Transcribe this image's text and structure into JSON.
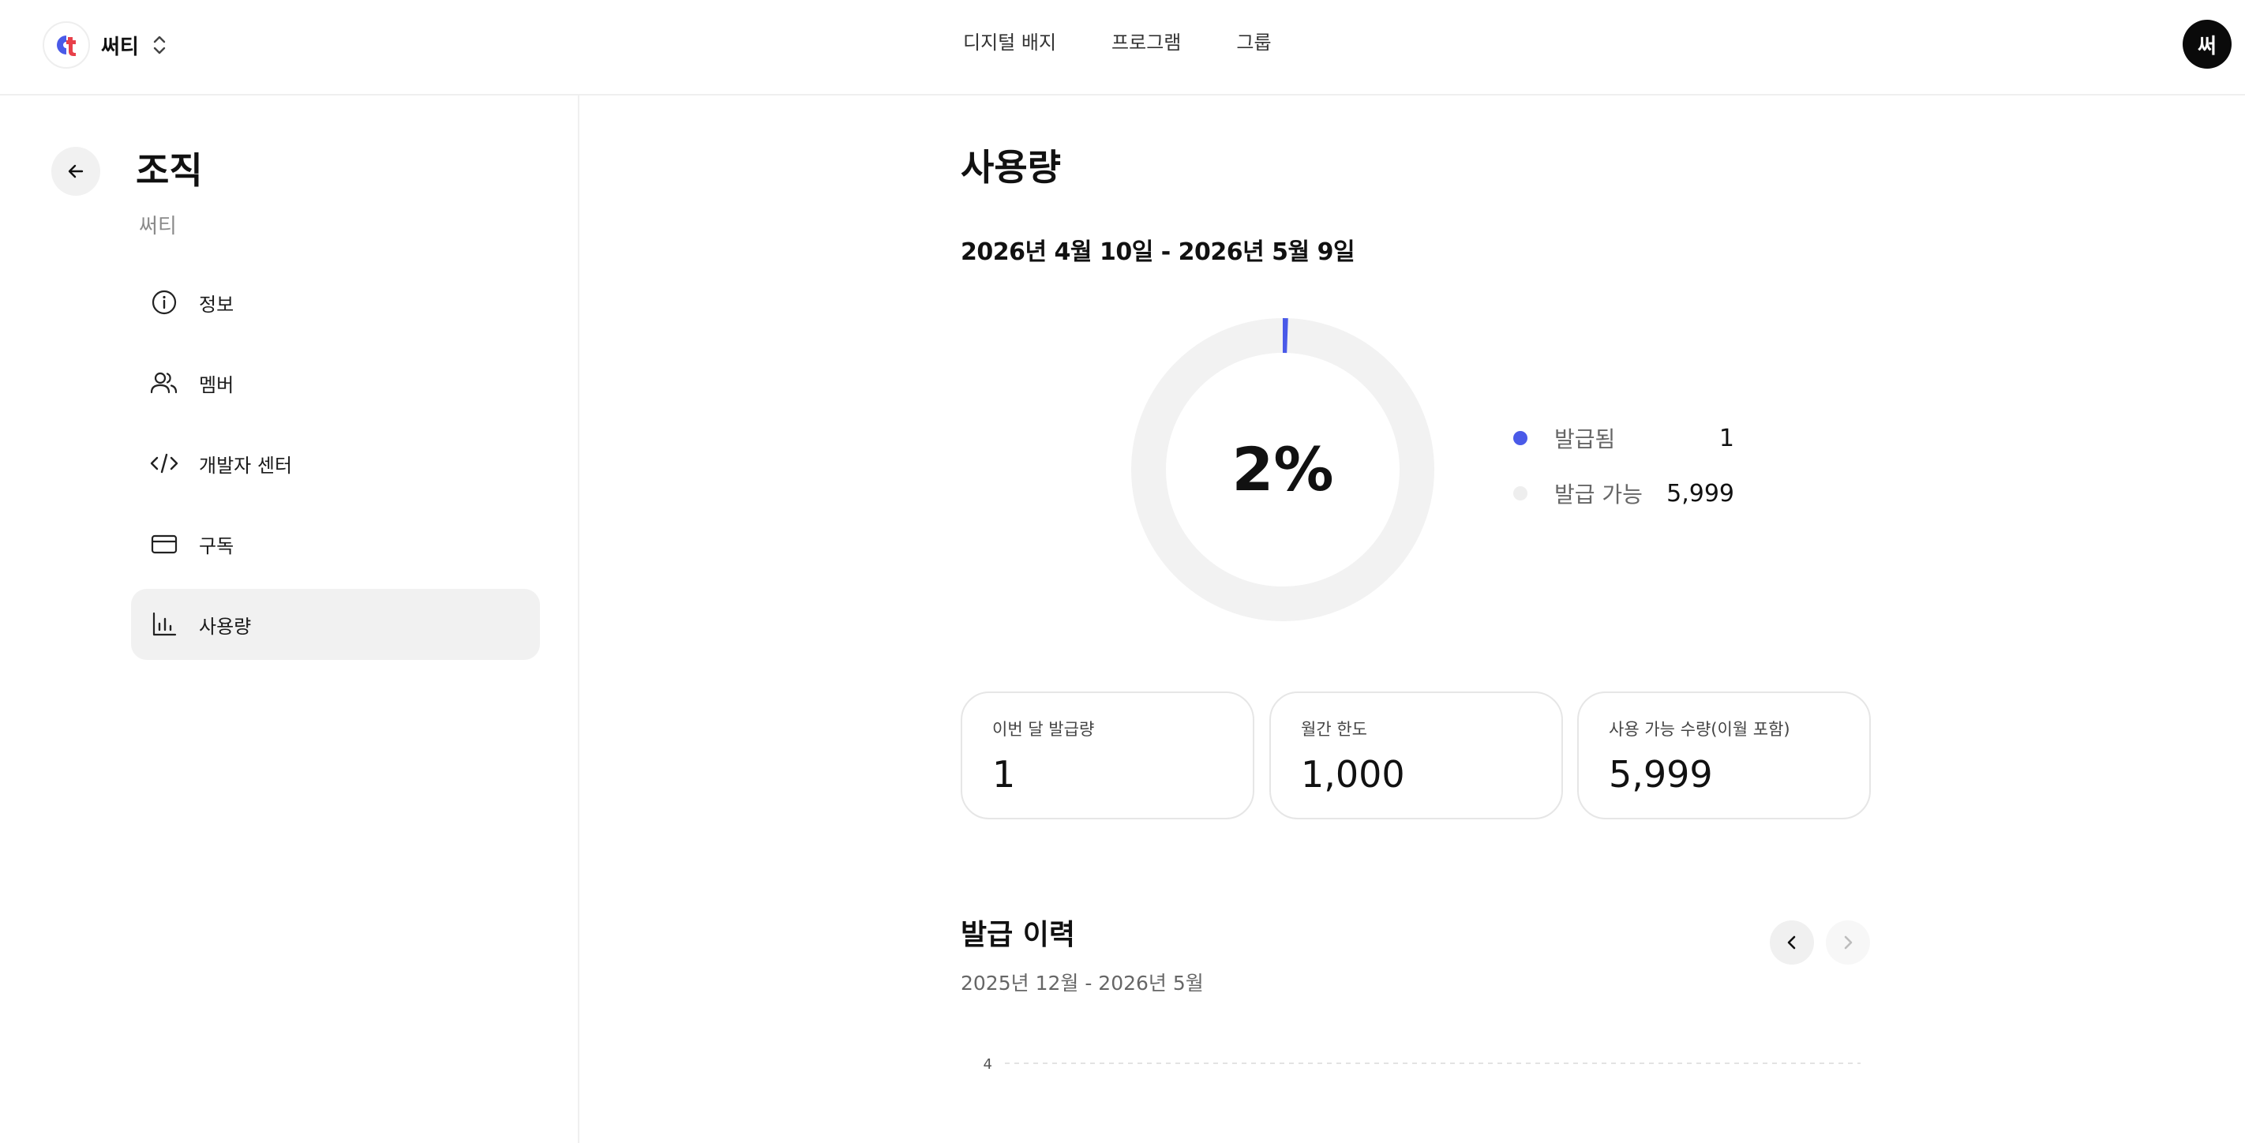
{
  "header": {
    "org_name": "써티",
    "nav": [
      "디지털 배지",
      "프로그램",
      "그룹"
    ],
    "avatar_initial": "써"
  },
  "sidebar": {
    "title": "조직",
    "subtitle": "써티",
    "items": [
      {
        "label": "정보",
        "icon": "info-icon"
      },
      {
        "label": "멤버",
        "icon": "users-icon"
      },
      {
        "label": "개발자 센터",
        "icon": "code-icon"
      },
      {
        "label": "구독",
        "icon": "credit-card-icon"
      },
      {
        "label": "사용량",
        "icon": "bar-chart-icon",
        "active": true
      }
    ]
  },
  "usage": {
    "title": "사용량",
    "period": "2026년 4월 10일 - 2026년 5월 9일",
    "percent_label": "2%",
    "legend": [
      {
        "label": "발급됨",
        "value": "1",
        "color": "#4a5ae8"
      },
      {
        "label": "발급 가능",
        "value": "5,999",
        "color": "#eeeeee"
      }
    ],
    "stats": [
      {
        "label": "이번 달 발급량",
        "value": "1"
      },
      {
        "label": "월간 한도",
        "value": "1,000"
      },
      {
        "label": "사용 가능 수량(이월 포함)",
        "value": "5,999"
      }
    ]
  },
  "chart_data": {
    "type": "pie",
    "categories": [
      "발급됨",
      "발급 가능"
    ],
    "values": [
      1,
      5999
    ],
    "colors": [
      "#4a5ae8",
      "#f2f2f2"
    ],
    "center_label": "2%"
  },
  "history": {
    "title": "발급 이력",
    "range": "2025년 12월 - 2026년 5월",
    "y_tick": "4"
  },
  "colors": {
    "accent": "#4a5ae8",
    "track": "#f2f2f2"
  }
}
